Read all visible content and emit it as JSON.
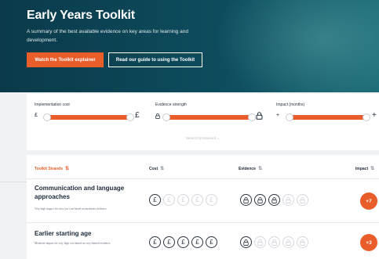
{
  "hero": {
    "title": "Early Years Toolkit",
    "description": "A summary of the best available evidence on key areas for learning and development.",
    "primary_button": "Watch the Toolkit explainer",
    "secondary_button": "Read our guide to using the Toolkit"
  },
  "filters": {
    "cost": {
      "label": "Implementation cost",
      "min_symbol": "£",
      "max_symbol": "£"
    },
    "evidence": {
      "label": "Evidence strength"
    },
    "impact": {
      "label": "Impact (months)",
      "min_symbol": "+",
      "max_symbol": "+"
    },
    "search_label": "Search by keyword"
  },
  "table": {
    "headers": {
      "strands": "Toolkit Strands",
      "cost": "Cost",
      "evidence": "Evidence",
      "impact": "Impact"
    },
    "rows": [
      {
        "title": "Communication and language approaches",
        "description": "Very high impact for very low cost based on moderate evidence.",
        "cost_level": 1,
        "evidence_level": 3,
        "impact": "+7"
      },
      {
        "title": "Earlier starting age",
        "description": "Moderate impact for very high cost based on very limited evidence.",
        "cost_level": 5,
        "evidence_level": 1,
        "impact": "+3"
      }
    ]
  },
  "icons": {
    "cost": "pound-icon",
    "evidence": "lock-icon",
    "sort": "sort-icon",
    "chevron": "chevron-down-icon"
  },
  "colors": {
    "accent": "#e85d2a",
    "hero_bg": "#0e4d5e",
    "page_bg": "#f1f2f4"
  }
}
